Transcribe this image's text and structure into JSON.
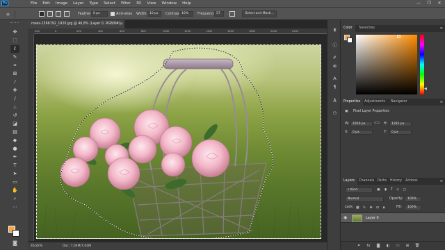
{
  "app": {
    "logo": "Ps"
  },
  "menu": [
    "File",
    "Edit",
    "Image",
    "Layer",
    "Type",
    "Select",
    "Filter",
    "3D",
    "View",
    "Window",
    "Help"
  ],
  "window_controls": [
    "—",
    "❐",
    "✕"
  ],
  "options_bar": {
    "feather_label": "Feather:",
    "feather_value": "0 px",
    "antialias_label": "Anti-alias",
    "width_label": "Width:",
    "width_value": "10 px",
    "contrast_label": "Contrast:",
    "contrast_value": "10%",
    "frequency_label": "Frequency:",
    "frequency_value": "57",
    "select_mask_label": "Select and Mask..."
  },
  "document": {
    "tab_title": "roses-1566792_1920.jpg @ 46,8% (Layer 0, RGB/8#)",
    "tab_close": "×",
    "zoom": "46,82%",
    "doc_info": "Doc: 7,04M/7,04M",
    "ruler_ticks": [
      "200",
      "0",
      "200",
      "400",
      "600",
      "800",
      "1000",
      "1200",
      "1400",
      "1600",
      "1800",
      "2000",
      "2200"
    ]
  },
  "color_panel": {
    "tabs": [
      "Color",
      "Swatches"
    ],
    "fg_color": "#f3a64a",
    "bg_color": "#ffffff"
  },
  "properties_panel": {
    "tabs": [
      "Properties",
      "Adjustments",
      "Navigator"
    ],
    "title": "Pixel Layer Properties",
    "w_label": "W:",
    "w_value": "1920 px",
    "h_label": "H:",
    "h_value": "1281 px",
    "x_label": "X:",
    "x_value": "0 px",
    "y_label": "Y:",
    "y_value": "0 px"
  },
  "layers_panel": {
    "tabs": [
      "Layers",
      "Channels",
      "Paths",
      "History",
      "Actions"
    ],
    "kind_label": "Kind",
    "blend_mode": "Normal",
    "opacity_label": "Opacity:",
    "opacity_value": "100%",
    "lock_label": "Lock:",
    "fill_label": "Fill:",
    "fill_value": "100%",
    "layers": [
      {
        "name": "Layer 0",
        "visible": true
      }
    ]
  }
}
